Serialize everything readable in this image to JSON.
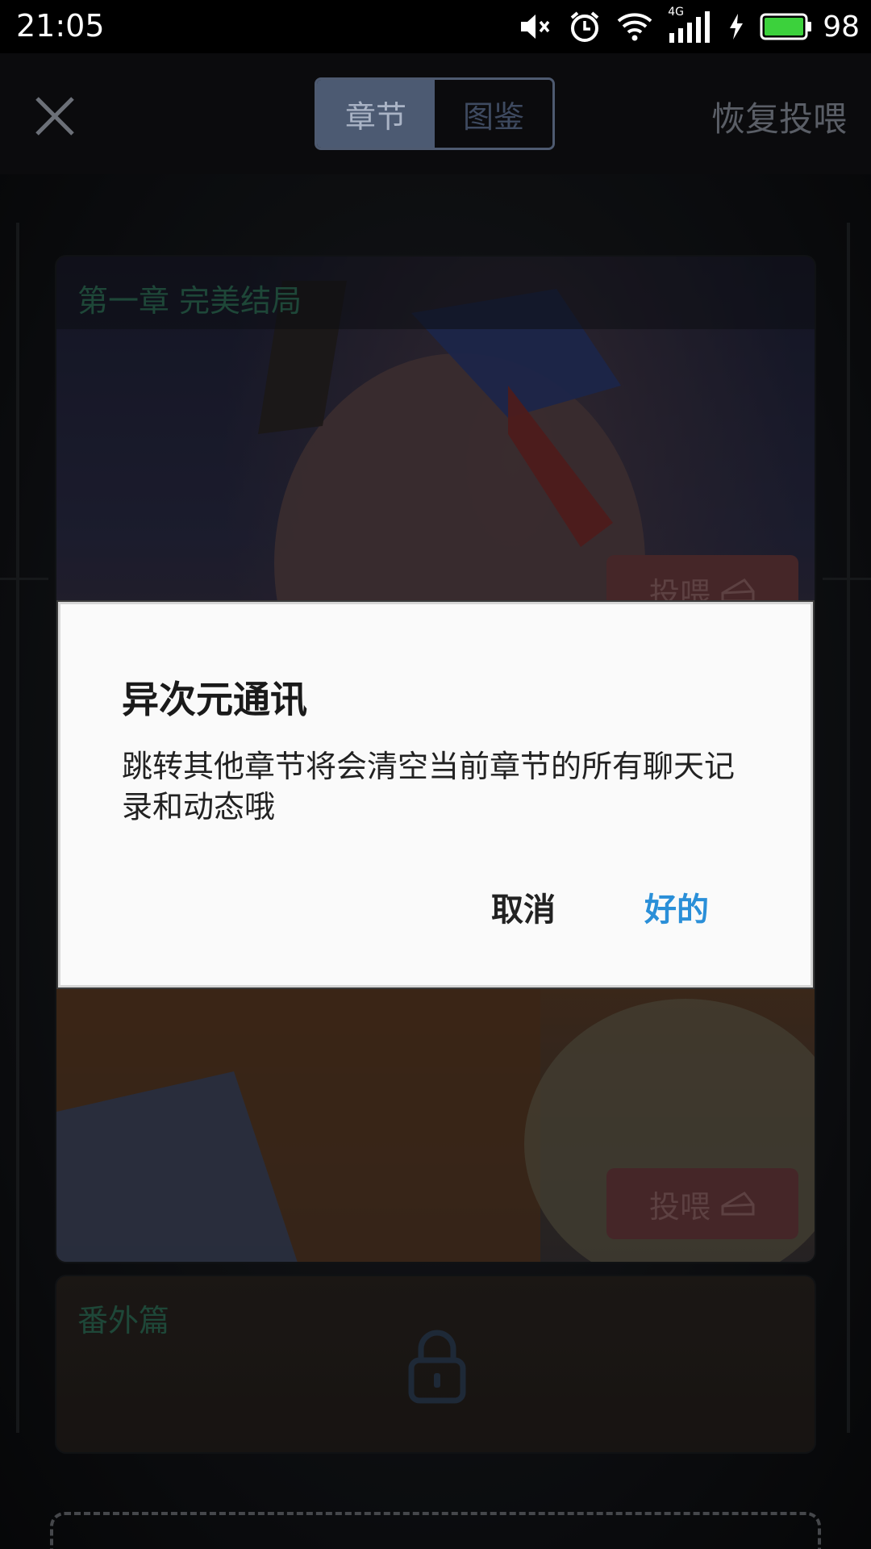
{
  "status_bar": {
    "time": "21:05",
    "network": "4G",
    "battery_percent": "98",
    "battery_level": 0.98,
    "icons": [
      "mute-icon",
      "alarm-icon",
      "wifi-icon",
      "signal-icon",
      "charging-icon",
      "battery-icon"
    ]
  },
  "nav": {
    "close_icon": "close-icon",
    "tabs": [
      {
        "label": "章节",
        "active": true
      },
      {
        "label": "图鉴",
        "active": false
      }
    ],
    "restore_label": "恢复投喂"
  },
  "chapters": [
    {
      "title": "第一章  完美结局",
      "feed_label": "投喂",
      "feed_icon": "cake-icon"
    },
    {
      "title": "",
      "feed_label": "投喂",
      "feed_icon": "cake-icon"
    },
    {
      "title": "番外篇",
      "locked": true,
      "lock_icon": "lock-icon"
    }
  ],
  "dialog": {
    "title": "异次元通讯",
    "message": "跳转其他章节将会清空当前章节的所有聊天记录和动态哦",
    "cancel_label": "取消",
    "ok_label": "好的"
  },
  "colors": {
    "accent_blue": "#2a8fd8",
    "chapter_title_green": "#2f6d57",
    "feed_button_red": "#6b3b3e",
    "active_tab": "#4c5a72"
  }
}
